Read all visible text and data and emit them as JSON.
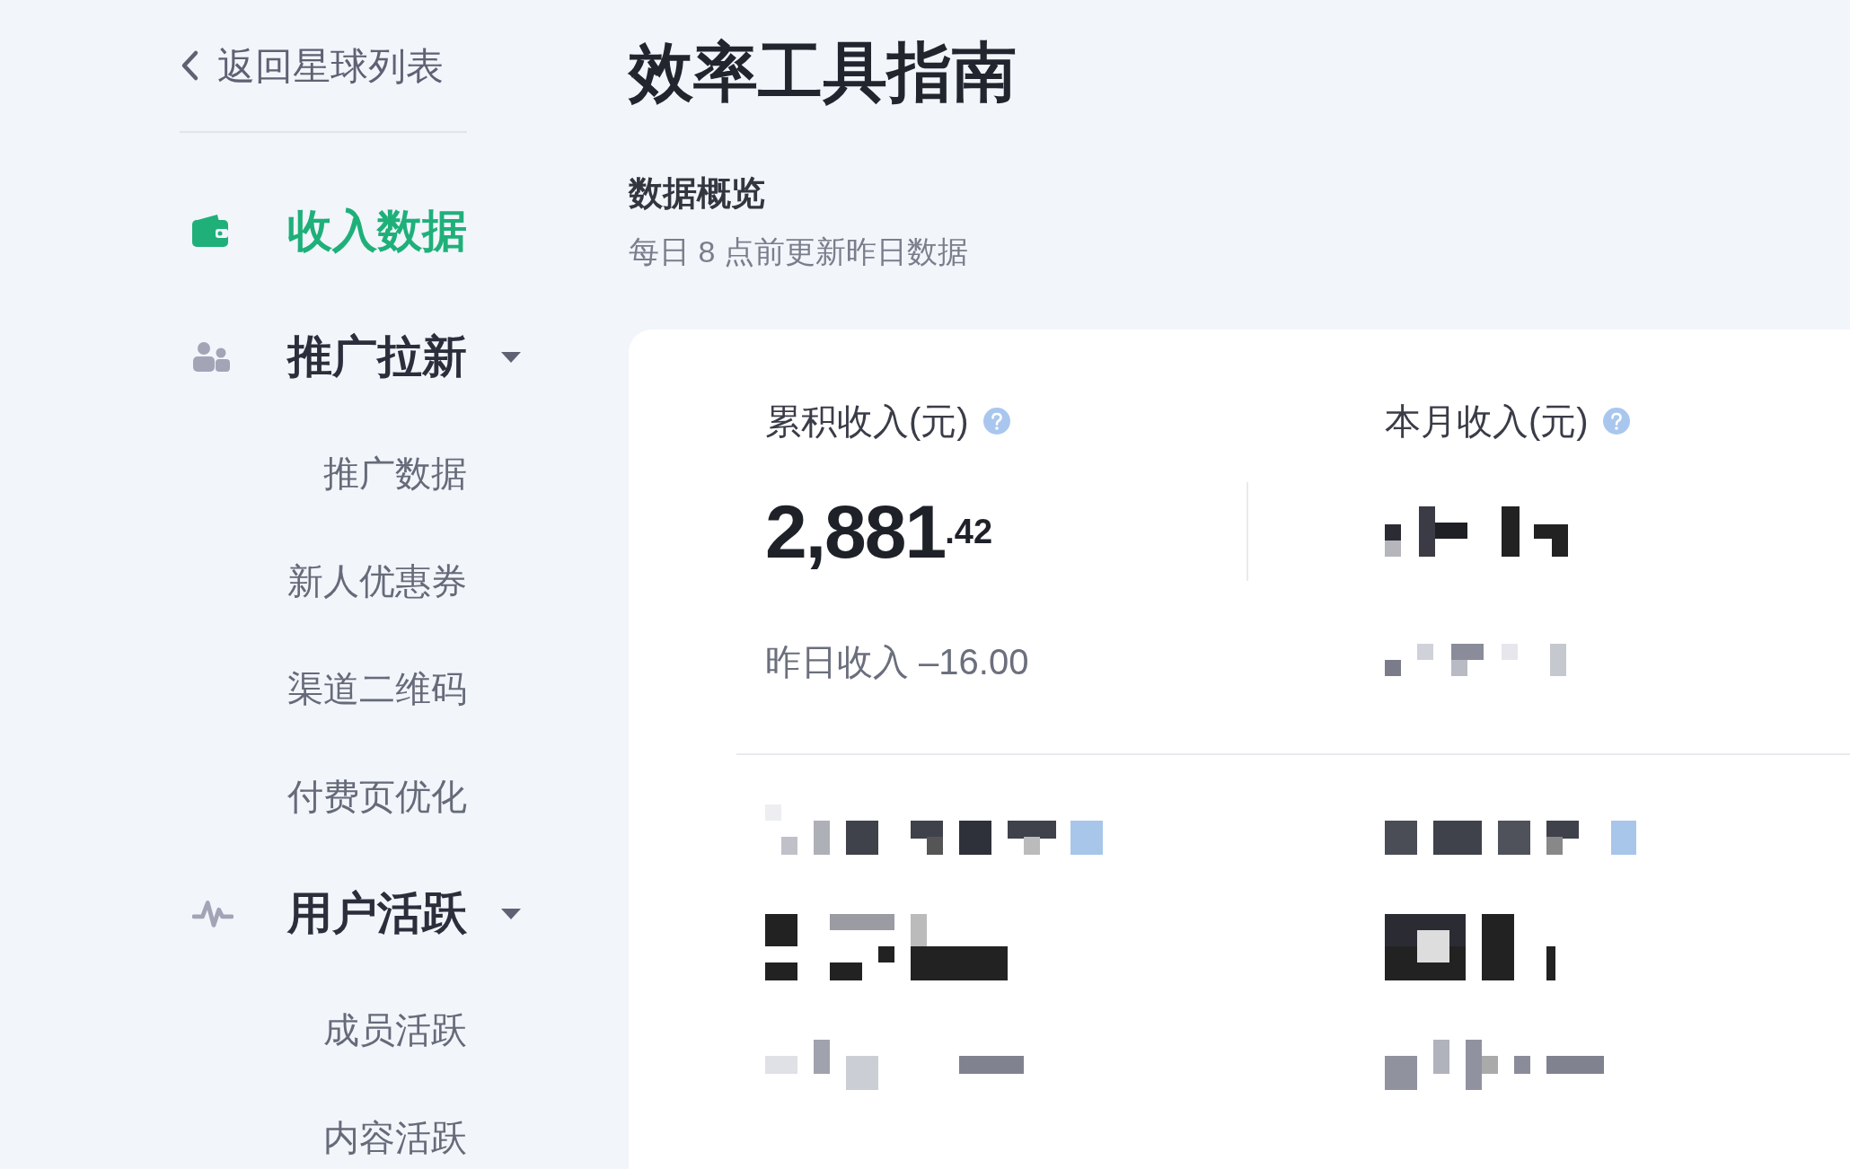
{
  "back_link": {
    "label": "返回星球列表"
  },
  "sidebar": {
    "groups": [
      {
        "label": "收入数据",
        "selected": true
      },
      {
        "label": "推广拉新",
        "selected": false,
        "expanded": true,
        "children": [
          {
            "label": "推广数据",
            "selected": false
          },
          {
            "label": "新人优惠券",
            "selected": false
          },
          {
            "label": "渠道二维码",
            "selected": false
          },
          {
            "label": "付费页优化",
            "selected": false
          }
        ]
      },
      {
        "label": "用户活跃",
        "selected": false,
        "expanded": true,
        "children": [
          {
            "label": "成员活跃",
            "selected": false
          },
          {
            "label": "内容活跃",
            "selected": false
          }
        ]
      }
    ]
  },
  "page_title": "效率工具指南",
  "overview": {
    "heading": "数据概览",
    "note": "每日 8 点前更新昨日数据"
  },
  "stats": [
    {
      "label": "累积收入(元)",
      "value": "2,881",
      "decimal": ".42",
      "sub": "昨日收入 –16.00"
    },
    {
      "label": "本月收入(元)"
    }
  ]
}
